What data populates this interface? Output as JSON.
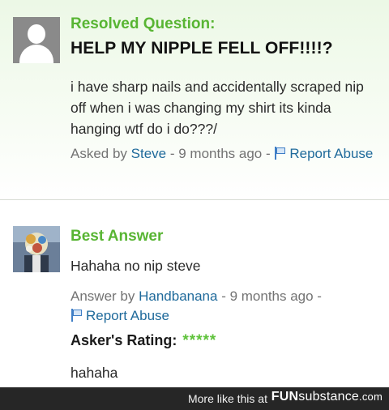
{
  "question": {
    "label": "Resolved Question:",
    "title": "HELP MY NIPPLE FELL OFF!!!!?",
    "body": "i have sharp nails and accidentally scraped nip off when i was changing my shirt its kinda hanging wtf do i do???/",
    "asked_prefix": "Asked by ",
    "asker": "Steve",
    "time": " - 9 months ago - ",
    "report": "Report Abuse"
  },
  "answer": {
    "label": "Best Answer",
    "body": "Hahaha no nip steve",
    "answer_prefix": "Answer by ",
    "answerer": "Handbanana",
    "time": " - 9 months ago - ",
    "report": "Report Abuse",
    "rating_label": "Asker's Rating:",
    "rating_stars": "*****",
    "rating": 5,
    "rating_max": 5,
    "comment": "hahaha"
  },
  "footer": {
    "text": "More like this at",
    "brand_fun": "FUN",
    "brand_rest": "substance",
    "brand_tld": ".com"
  },
  "colors": {
    "accent_green": "#58b533",
    "link_blue": "#1f6a9b",
    "star_green": "#5ec23a"
  }
}
